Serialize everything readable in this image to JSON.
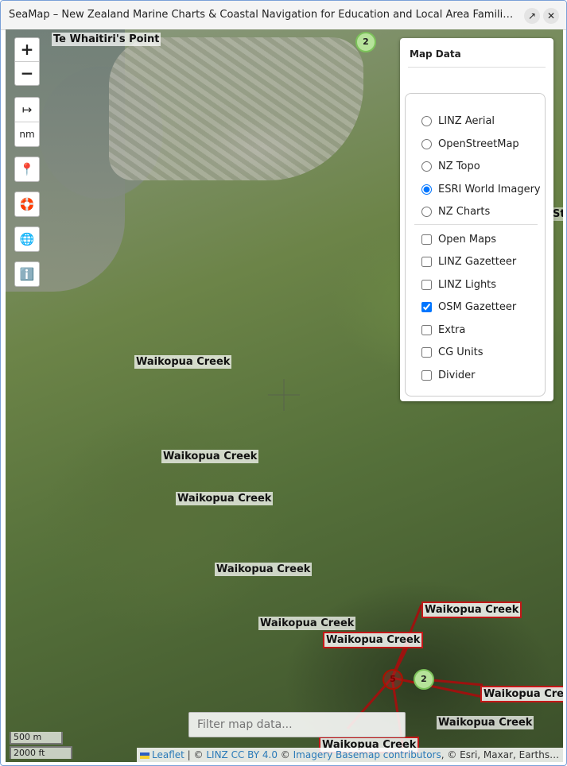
{
  "window": {
    "title": "SeaMap – New Zealand Marine Charts & Coastal Navigation for Education and Local Area Familiarisation",
    "popout_icon": "popout-icon",
    "close_icon": "close-icon"
  },
  "controls": {
    "zoom_in": "+",
    "zoom_out": "−",
    "measure_icon": "↦",
    "unit_label": "nm",
    "location_icon": "📍",
    "lifebuoy_icon": "🛟",
    "globe_icon": "🌐",
    "info_icon": "ℹ️"
  },
  "panel": {
    "title": "Map Data",
    "base_layers": [
      {
        "label": "LINZ Aerial",
        "selected": false
      },
      {
        "label": "OpenStreetMap",
        "selected": false
      },
      {
        "label": "NZ Topo",
        "selected": false
      },
      {
        "label": "ESRI World Imagery",
        "selected": true
      },
      {
        "label": "NZ Charts",
        "selected": false
      }
    ],
    "overlays": [
      {
        "label": "Open Maps",
        "checked": false
      },
      {
        "label": "LINZ Gazetteer",
        "checked": false
      },
      {
        "label": "LINZ Lights",
        "checked": false
      },
      {
        "label": "OSM Gazetteer",
        "checked": true
      },
      {
        "label": "Extra",
        "checked": false
      },
      {
        "label": "CG Units",
        "checked": false
      },
      {
        "label": "Divider",
        "checked": false
      }
    ]
  },
  "map": {
    "labels": [
      "Te Whaitiri's Point",
      "Waikopua Creek",
      "Waikopua Creek",
      "Waikopua Creek",
      "Waikopua Creek",
      "Waikopua Creek",
      "Waikopua Creek",
      "Waikopua Creek",
      "Waikopua Creek",
      "Waikopua Cree",
      "Waikopua Creek",
      "Waikopua Creek"
    ],
    "clusters": [
      "2",
      "2",
      "5"
    ],
    "edge_partial_label": "Str"
  },
  "search": {
    "placeholder": "Filter map data..."
  },
  "scale": {
    "metric": "500 m",
    "imperial": "2000 ft"
  },
  "attribution": {
    "leaflet": "Leaflet",
    "sep1": " | © ",
    "linz": "LINZ CC BY 4.0",
    "sep2": " © ",
    "imagery": "Imagery Basemap contributors",
    "rest": ", © Esri, Maxar, Earthstar Geographics"
  }
}
